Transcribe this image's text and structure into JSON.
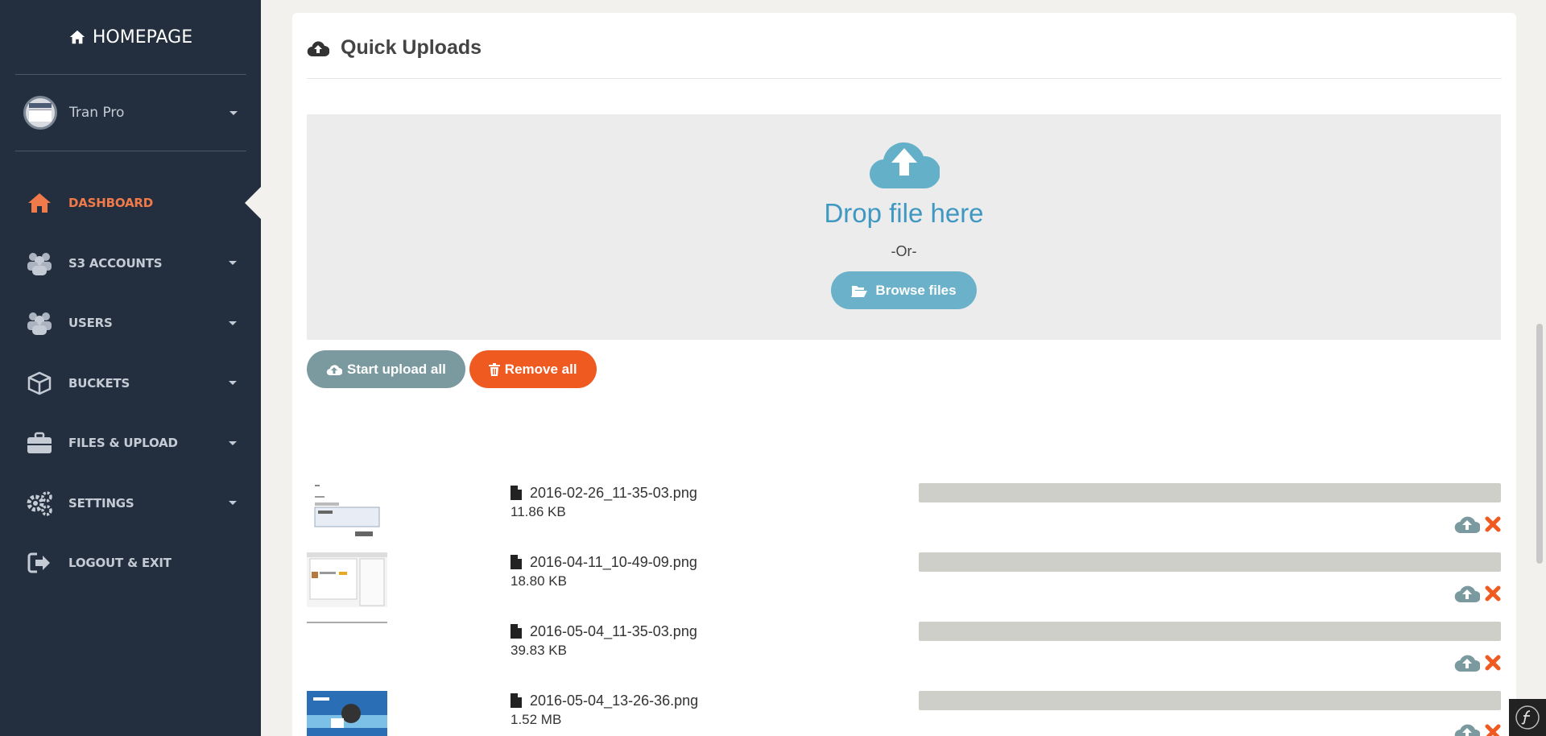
{
  "sidebar": {
    "brand": "HOMEPAGE",
    "user_name": "Tran Pro",
    "items": [
      {
        "label": "DASHBOARD",
        "icon": "home-icon",
        "active": true
      },
      {
        "label": "S3 ACCOUNTS",
        "icon": "users-icon"
      },
      {
        "label": "USERS",
        "icon": "users-icon"
      },
      {
        "label": "BUCKETS",
        "icon": "cube-icon"
      },
      {
        "label": "FILES & UPLOAD",
        "icon": "briefcase-icon"
      },
      {
        "label": "SETTINGS",
        "icon": "gears-icon"
      },
      {
        "label": "LOGOUT & EXIT",
        "icon": "sign-out-icon"
      }
    ]
  },
  "panel": {
    "title": "Quick Uploads",
    "dropzone_title": "Drop file here",
    "dropzone_or": "-Or-",
    "browse_label": "Browse files",
    "start_all_label": "Start upload all",
    "remove_all_label": "Remove all"
  },
  "files": [
    {
      "name": "2016-02-26_11-35-03.png",
      "size": "11.86 KB",
      "progress": 0
    },
    {
      "name": "2016-04-11_10-49-09.png",
      "size": "18.80 KB",
      "progress": 0
    },
    {
      "name": "2016-05-04_11-35-03.png",
      "size": "39.83 KB",
      "progress": 0
    },
    {
      "name": "2016-05-04_13-26-36.png",
      "size": "1.52 MB",
      "progress": 0
    }
  ],
  "colors": {
    "sidebar_bg": "#232f3e",
    "accent_orange": "#f17a4a",
    "remove_red": "#ef5a21",
    "upload_teal": "#6bb1ca",
    "drop_title": "#3f98c2"
  }
}
